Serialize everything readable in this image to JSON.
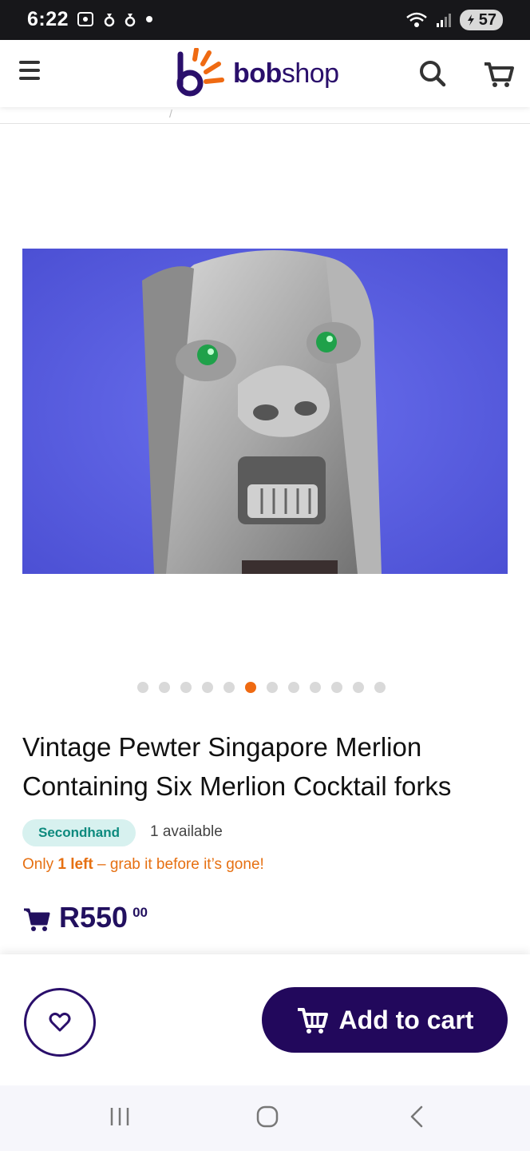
{
  "status_bar": {
    "time": "6:22",
    "battery": "57",
    "left_icons": [
      "screenshot-icon",
      "notification-icon",
      "notification-icon",
      "dot-icon"
    ],
    "right_icons": [
      "wifi-icon",
      "signal-icon",
      "battery-icon"
    ]
  },
  "header": {
    "logo_bold": "bob",
    "logo_light": "shop",
    "icons": [
      "menu-icon",
      "search-icon",
      "cart-icon"
    ],
    "brand_color": "#2a0f6b",
    "accent_color": "#ef6a12"
  },
  "gallery": {
    "image_count": 12,
    "active_index": 5
  },
  "product": {
    "title": "Vintage Pewter Singapore Merlion Containing Six Merlion Cocktail forks",
    "condition": "Secondhand",
    "availability": "1 available",
    "urgency_prefix": "Only ",
    "urgency_bold": "1 left",
    "urgency_suffix": " – grab it before it’s gone!",
    "price_main": "R550",
    "price_cents": "00"
  },
  "actions": {
    "add_to_cart_label": "Add to cart",
    "wishlist_icon": "heart-icon"
  },
  "system_nav": {
    "icons": [
      "recents-icon",
      "home-icon",
      "back-icon"
    ]
  }
}
